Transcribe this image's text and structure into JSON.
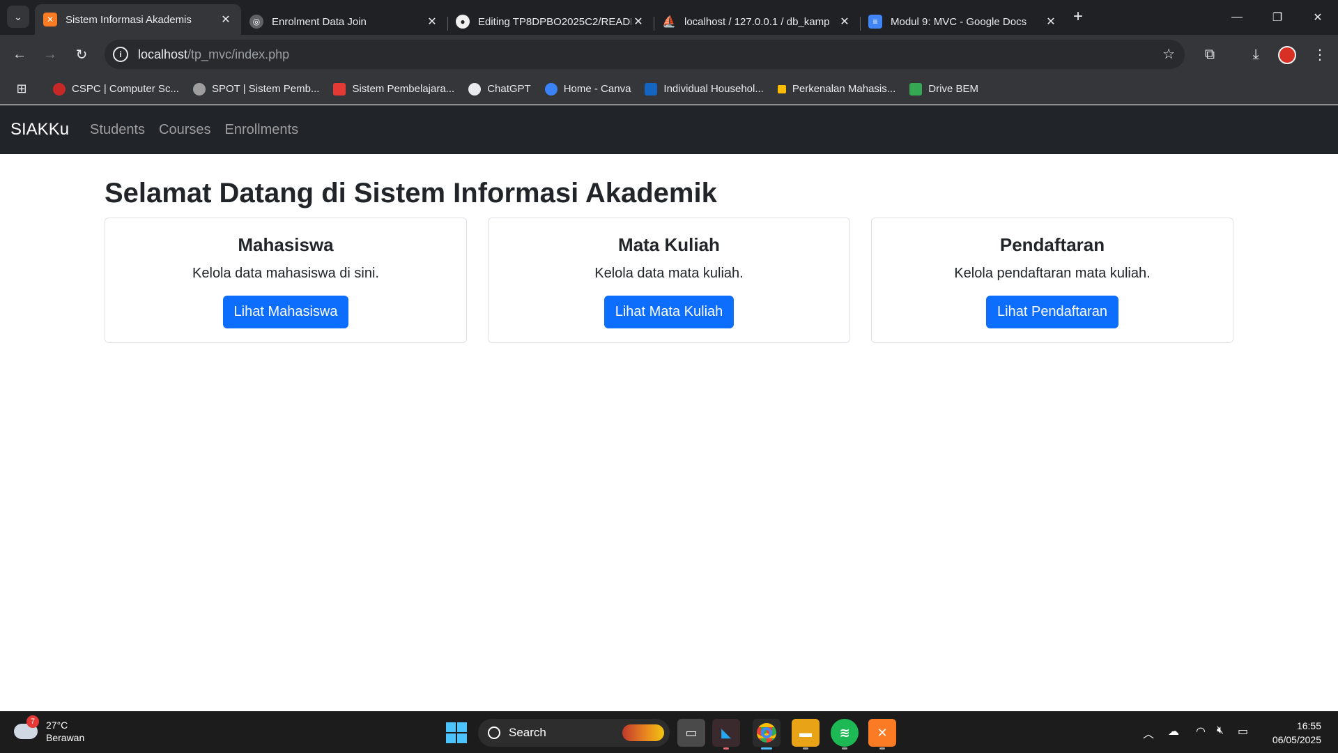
{
  "browser": {
    "tabs": [
      {
        "title": "Sistem Informasi Akademis",
        "active": true,
        "favicon": "xampp-icon",
        "color": "#fb7a24"
      },
      {
        "title": "Enrolment Data Join",
        "active": false,
        "favicon": "chatgpt-icon",
        "color": "#5f6368"
      },
      {
        "title": "Editing TP8DPBO2025C2/READI",
        "active": false,
        "favicon": "github-icon",
        "color": "#5f6368"
      },
      {
        "title": "localhost / 127.0.0.1 / db_kamp",
        "active": false,
        "favicon": "phpmyadmin-icon",
        "color": "#f29111"
      },
      {
        "title": "Modul 9: MVC - Google Docs",
        "active": false,
        "favicon": "google-docs-icon",
        "color": "#4285f4"
      }
    ],
    "url_host": "localhost",
    "url_path": "/tp_mvc/index.php",
    "bookmarks": [
      {
        "label": "CSPC | Computer Sc...",
        "color": "#c62828"
      },
      {
        "label": "SPOT | Sistem Pemb...",
        "color": "#9e9e9e"
      },
      {
        "label": "Sistem Pembelajara...",
        "color": "#e53935"
      },
      {
        "label": "ChatGPT",
        "color": "#e8eaed"
      },
      {
        "label": "Home - Canva",
        "color": "#3b82f6"
      },
      {
        "label": "Individual Househol...",
        "color": "#1565c0"
      },
      {
        "label": "Perkenalan Mahasis...",
        "color": "#fbbc04"
      },
      {
        "label": "Drive BEM",
        "color": "#34a853"
      }
    ]
  },
  "navbar": {
    "brand": "SIAKKu",
    "links": [
      "Students",
      "Courses",
      "Enrollments"
    ]
  },
  "main": {
    "title": "Selamat Datang di Sistem Informasi Akademik",
    "cards": [
      {
        "title": "Mahasiswa",
        "text": "Kelola data mahasiswa di sini.",
        "button": "Lihat Mahasiswa"
      },
      {
        "title": "Mata Kuliah",
        "text": "Kelola data mata kuliah.",
        "button": "Lihat Mata Kuliah"
      },
      {
        "title": "Pendaftaran",
        "text": "Kelola pendaftaran mata kuliah.",
        "button": "Lihat Pendaftaran"
      }
    ]
  },
  "taskbar": {
    "weather_temp": "27°C",
    "weather_desc": "Berawan",
    "weather_badge": "7",
    "search_label": "Search",
    "time": "16:55",
    "date": "06/05/2025"
  },
  "colors": {
    "primary": "#0d6efd",
    "navbar_bg": "#212529",
    "chrome_bg": "#202124"
  }
}
